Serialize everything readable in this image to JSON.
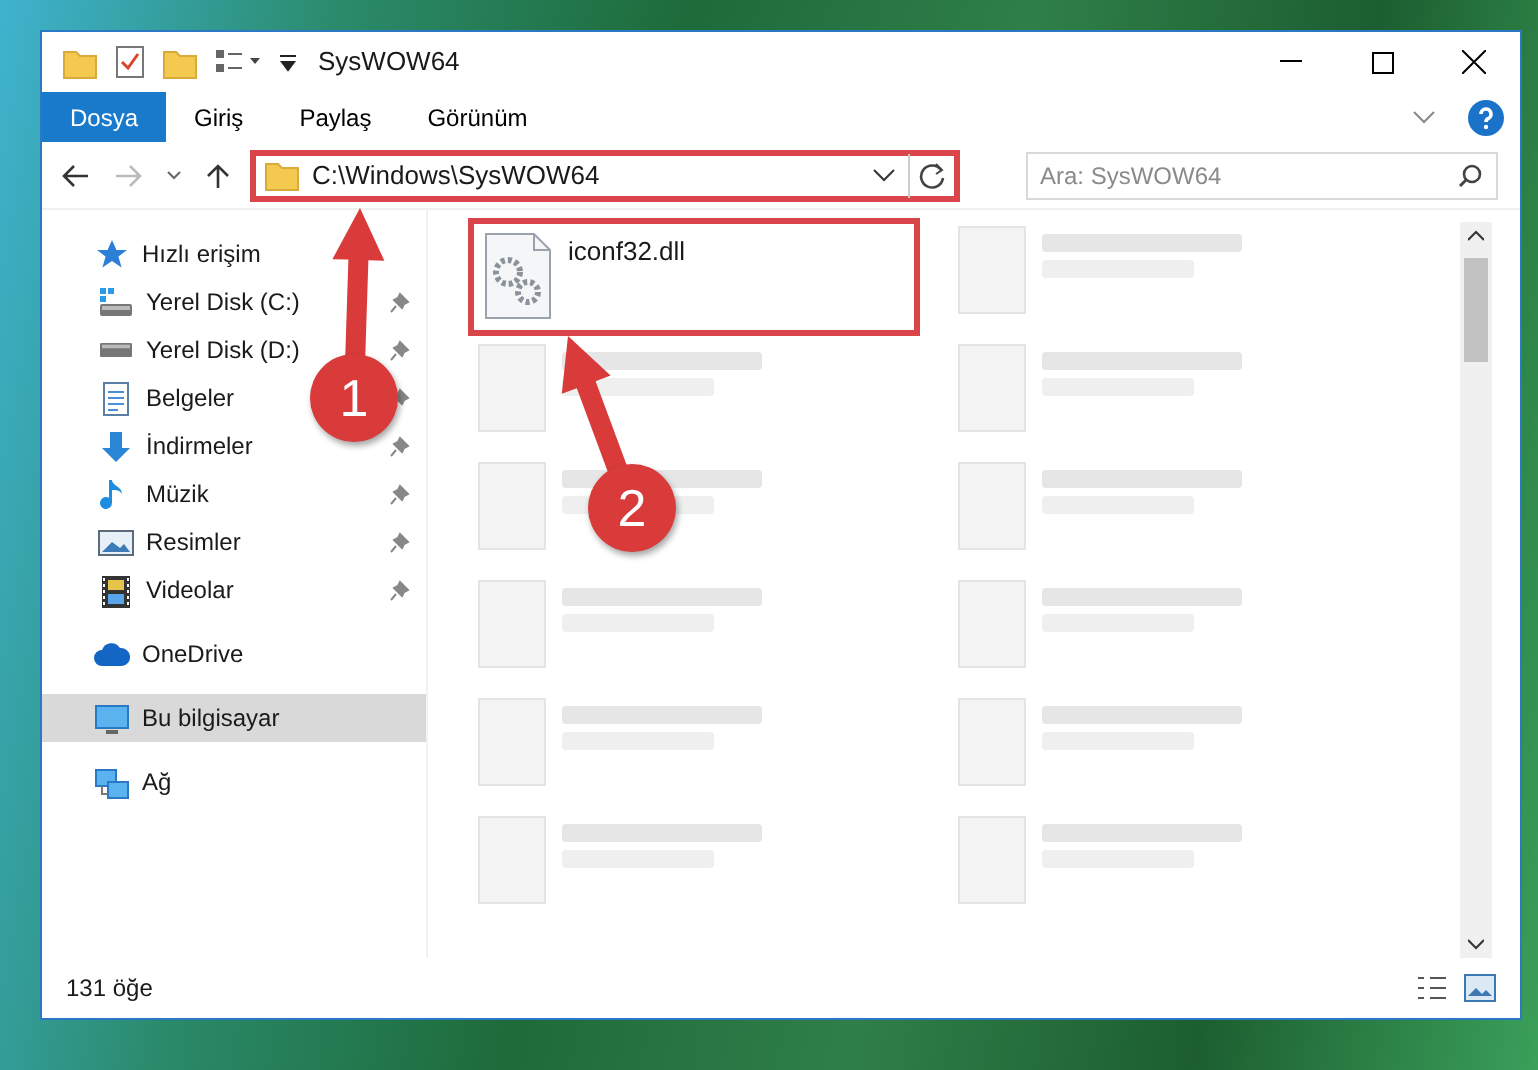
{
  "window": {
    "title": "SysWOW64"
  },
  "ribbon_tabs": [
    {
      "label": "Dosya",
      "kind": "file"
    },
    {
      "label": "Giriş",
      "kind": "tab"
    },
    {
      "label": "Paylaş",
      "kind": "tab"
    },
    {
      "label": "Görünüm",
      "kind": "tab"
    }
  ],
  "address_bar": {
    "path": "C:\\Windows\\SysWOW64",
    "highlighted": true
  },
  "search": {
    "placeholder": "Ara: SysWOW64"
  },
  "sidebar": {
    "items": [
      {
        "label": "Hızlı erişim",
        "kind": "star",
        "selected": false,
        "children": [
          {
            "label": "Yerel Disk (C:)",
            "kind": "system-drive",
            "pinned": true,
            "selected": false
          },
          {
            "label": "Yerel Disk (D:)",
            "kind": "drive",
            "pinned": true,
            "selected": false
          },
          {
            "label": "Belgeler",
            "kind": "documents",
            "pinned": true,
            "selected": false
          },
          {
            "label": "İndirmeler",
            "kind": "downloads",
            "pinned": true,
            "selected": false
          },
          {
            "label": "Müzik",
            "kind": "music",
            "pinned": true,
            "selected": false
          },
          {
            "label": "Resimler",
            "kind": "pictures",
            "pinned": true,
            "selected": false
          },
          {
            "label": "Videolar",
            "kind": "videos",
            "pinned": true,
            "selected": false
          }
        ]
      },
      {
        "label": "OneDrive",
        "kind": "cloud",
        "selected": false
      },
      {
        "label": "Bu bilgisayar",
        "kind": "computer",
        "selected": true
      },
      {
        "label": "Ağ",
        "kind": "network",
        "selected": false
      }
    ]
  },
  "files": [
    {
      "kind": "file",
      "name": "iconf32.dll",
      "highlighted": true
    },
    {
      "kind": "blurred"
    },
    {
      "kind": "blurred"
    },
    {
      "kind": "blurred"
    },
    {
      "kind": "blurred"
    },
    {
      "kind": "blurred"
    },
    {
      "kind": "blurred"
    },
    {
      "kind": "blurred"
    },
    {
      "kind": "blurred"
    },
    {
      "kind": "blurred"
    },
    {
      "kind": "blurred"
    },
    {
      "kind": "blurred"
    }
  ],
  "status_bar": {
    "item_count": "131 öğe"
  },
  "annotations": [
    {
      "number": "1"
    },
    {
      "number": "2"
    }
  ]
}
